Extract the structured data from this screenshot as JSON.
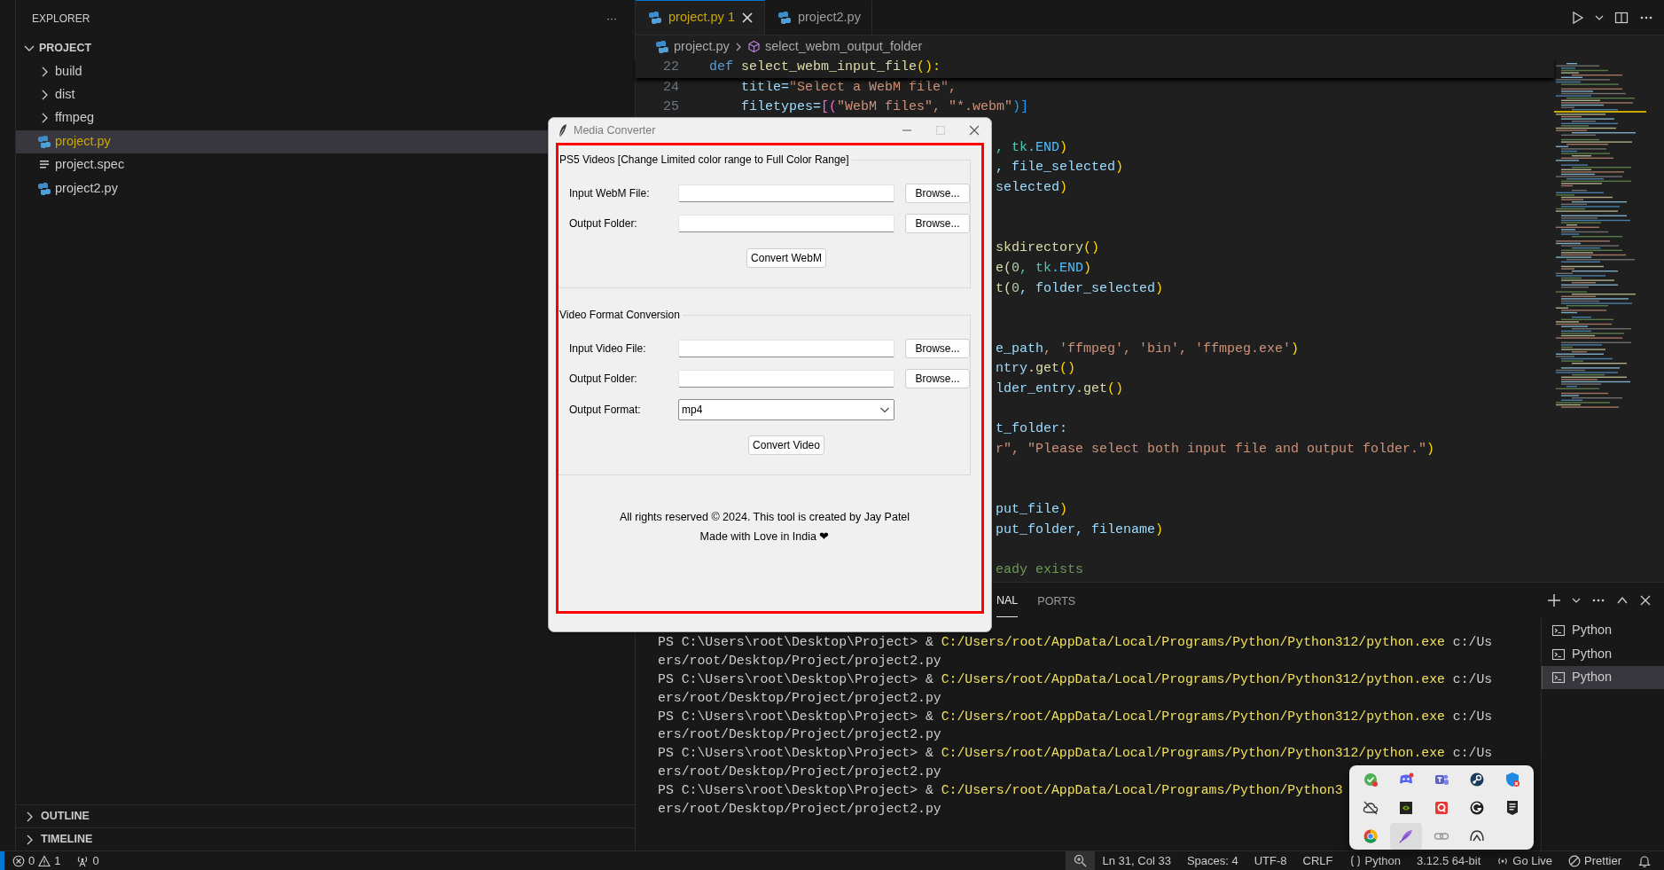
{
  "explorer": {
    "title": "EXPLORER",
    "more": "···",
    "folder": {
      "name": "PROJECT",
      "expanded": true,
      "children": [
        {
          "name": "build",
          "kind": "folder",
          "expanded": false,
          "selected": false,
          "warning": false
        },
        {
          "name": "dist",
          "kind": "folder",
          "expanded": false,
          "selected": false,
          "warning": false
        },
        {
          "name": "ffmpeg",
          "kind": "folder",
          "expanded": false,
          "selected": false,
          "warning": false
        },
        {
          "name": "project.py",
          "kind": "python",
          "selected": true,
          "warning": true
        },
        {
          "name": "project.spec",
          "kind": "text",
          "selected": false,
          "warning": false
        },
        {
          "name": "project2.py",
          "kind": "python",
          "selected": false,
          "warning": false
        }
      ]
    }
  },
  "sections": [
    {
      "name": "OUTLINE",
      "expanded": false
    },
    {
      "name": "TIMELINE",
      "expanded": false
    }
  ],
  "tabs": [
    {
      "label": "project.py",
      "badge": "1",
      "selected": true,
      "warning": true
    },
    {
      "label": "project2.py",
      "selected": false,
      "warning": false
    }
  ],
  "breadcrumb": [
    "project.py",
    "select_webm_output_folder"
  ],
  "editor": {
    "lines": [
      {
        "kind": "code",
        "number": "22",
        "tokens": [
          {
            "text": "def",
            "color": "#569cd6"
          },
          {
            "text": " select_webm_input_file",
            "color": "#dcdcaa"
          },
          {
            "text": "():",
            "color": "#ffd700"
          }
        ]
      },
      {
        "kind": "code",
        "number": "24",
        "tokens": [
          {
            "text": "    title=",
            "color": "#9cdcfe"
          },
          {
            "text": "\"Select a WebM file\",",
            "color": "#ce9178"
          }
        ]
      },
      {
        "kind": "code",
        "number": "25",
        "tokens": [
          {
            "text": "    filetypes=",
            "color": "#9cdcfe"
          },
          {
            "text": "[(",
            "color": "#da70d6"
          },
          {
            "text": "\"WebM files\", \"*.webm\"",
            "color": "#ce9178"
          },
          {
            "text": ")]",
            "color": "#179fff"
          }
        ]
      },
      {
        "kind": "blank"
      },
      {
        "kind": "fragment",
        "tokens": [
          {
            "text": ", tk",
            "color": "#4ec9b0"
          },
          {
            "text": ".END",
            "color": "#4fc1ff"
          },
          {
            "text": ")",
            "color": "#ffd700"
          }
        ]
      },
      {
        "kind": "fragment",
        "tokens": [
          {
            "text": ", file_selected",
            "color": "#9cdcfe"
          },
          {
            "text": ")",
            "color": "#ffd700"
          }
        ]
      },
      {
        "kind": "fragment",
        "tokens": [
          {
            "text": "selected",
            "color": "#9cdcfe"
          },
          {
            "text": ")",
            "color": "#ffd700"
          }
        ]
      },
      {
        "kind": "blank"
      },
      {
        "kind": "blank"
      },
      {
        "kind": "fragment",
        "tokens": [
          {
            "text": "skdirectory",
            "color": "#dcdcaa"
          },
          {
            "text": "()",
            "color": "#ffd700"
          }
        ]
      },
      {
        "kind": "fragment",
        "tokens": [
          {
            "text": "e(",
            "color": "#dcdcaa"
          },
          {
            "text": "0",
            "color": "#b5cea8"
          },
          {
            "text": ", tk",
            "color": "#4ec9b0"
          },
          {
            "text": ".END",
            "color": "#4fc1ff"
          },
          {
            "text": ")",
            "color": "#ffd700"
          }
        ]
      },
      {
        "kind": "fragment",
        "tokens": [
          {
            "text": "t(",
            "color": "#dcdcaa"
          },
          {
            "text": "0",
            "color": "#b5cea8"
          },
          {
            "text": ", folder_selected",
            "color": "#9cdcfe"
          },
          {
            "text": ")",
            "color": "#ffd700"
          }
        ]
      },
      {
        "kind": "blank"
      },
      {
        "kind": "blank"
      },
      {
        "kind": "fragment",
        "tokens": [
          {
            "text": "e_path",
            "color": "#9cdcfe"
          },
          {
            "text": ", 'ffmpeg', 'bin', 'ffmpeg.exe'",
            "color": "#ce9178"
          },
          {
            "text": ")",
            "color": "#ffd700"
          }
        ]
      },
      {
        "kind": "fragment",
        "tokens": [
          {
            "text": "ntry",
            "color": "#9cdcfe"
          },
          {
            "text": ".get",
            "color": "#dcdcaa"
          },
          {
            "text": "()",
            "color": "#ffd700"
          }
        ]
      },
      {
        "kind": "fragment",
        "tokens": [
          {
            "text": "lder_entry",
            "color": "#9cdcfe"
          },
          {
            "text": ".get",
            "color": "#dcdcaa"
          },
          {
            "text": "()",
            "color": "#ffd700"
          }
        ]
      },
      {
        "kind": "blank"
      },
      {
        "kind": "fragment",
        "tokens": [
          {
            "text": "t_folder:",
            "color": "#9cdcfe"
          }
        ]
      },
      {
        "kind": "fragment",
        "tokens": [
          {
            "text": "r\", \"Please select both input file and output folder.\"",
            "color": "#ce9178"
          },
          {
            "text": ")",
            "color": "#ffd700"
          }
        ]
      },
      {
        "kind": "blank"
      },
      {
        "kind": "blank"
      },
      {
        "kind": "fragment",
        "tokens": [
          {
            "text": "put_file",
            "color": "#9cdcfe"
          },
          {
            "text": ")",
            "color": "#ffd700"
          }
        ]
      },
      {
        "kind": "fragment",
        "tokens": [
          {
            "text": "put_folder, filename",
            "color": "#9cdcfe"
          },
          {
            "text": ")",
            "color": "#ffd700"
          }
        ]
      },
      {
        "kind": "blank"
      },
      {
        "kind": "fragment",
        "tokens": [
          {
            "text": "eady exists",
            "color": "#6a9955"
          }
        ]
      }
    ]
  },
  "dialog": {
    "title": "Media Converter",
    "groups": [
      {
        "title": "PS5 Videos [Change Limited color range to Full Color Range]",
        "fields": [
          {
            "label": "Input WebM File:",
            "kind": "entry",
            "button": "Browse..."
          },
          {
            "label": "Output Folder:",
            "kind": "entry",
            "button": "Browse..."
          }
        ],
        "action": "Convert WebM"
      },
      {
        "title": "Video Format Conversion",
        "fields": [
          {
            "label": "Input Video File:",
            "kind": "entry",
            "button": "Browse..."
          },
          {
            "label": "Output Folder:",
            "kind": "entry",
            "button": "Browse..."
          },
          {
            "label": "Output Format:",
            "kind": "combo",
            "value": "mp4"
          }
        ],
        "action": "Convert Video"
      }
    ],
    "footer": [
      "All rights reserved © 2024. This tool is created by Jay Patel",
      "Made with Love in India ❤"
    ]
  },
  "panel": {
    "tabs": [
      {
        "label": "NAL",
        "selected": true
      },
      {
        "label": "PORTS",
        "selected": false
      }
    ],
    "terminal_lines": [
      {
        "kind": "command",
        "prompt": "PS C:\\Users\\root\\Desktop\\Project> & ",
        "path": "C:/Users/root/AppData/Local/Programs/Python/Python312/python.exe",
        "arg": " c:/Us"
      },
      {
        "kind": "output",
        "text": "ers/root/Desktop/Project/project2.py"
      },
      {
        "kind": "command",
        "prompt": "PS C:\\Users\\root\\Desktop\\Project> & ",
        "path": "C:/Users/root/AppData/Local/Programs/Python/Python312/python.exe",
        "arg": " c:/Us"
      },
      {
        "kind": "output",
        "text": "ers/root/Desktop/Project/project2.py"
      },
      {
        "kind": "command",
        "prompt": "PS C:\\Users\\root\\Desktop\\Project> & ",
        "path": "C:/Users/root/AppData/Local/Programs/Python/Python312/python.exe",
        "arg": " c:/Us"
      },
      {
        "kind": "output",
        "text": "ers/root/Desktop/Project/project2.py"
      },
      {
        "kind": "command",
        "prompt": "PS C:\\Users\\root\\Desktop\\Project> & ",
        "path": "C:/Users/root/AppData/Local/Programs/Python/Python312/python.exe",
        "arg": " c:/Us"
      },
      {
        "kind": "output",
        "text": "ers/root/Desktop/Project/project2.py"
      },
      {
        "kind": "command",
        "prompt": "PS C:\\Users\\root\\Desktop\\Project> & ",
        "path": "C:/Users/root/AppData/Local/Programs/Python/Python3"
      },
      {
        "kind": "output",
        "text": "ers/root/Desktop/Project/project2.py"
      }
    ],
    "terminals": [
      {
        "label": "Python",
        "selected": false
      },
      {
        "label": "Python",
        "selected": false
      },
      {
        "label": "Python",
        "selected": true
      }
    ]
  },
  "status_bar": {
    "errors": "0",
    "warnings": "1",
    "ports": "0",
    "position": "Ln 31, Col 33",
    "indent": "Spaces: 4",
    "encoding": "UTF-8",
    "eol": "CRLF",
    "language": "Python",
    "interpreter": "3.12.5 64-bit",
    "live": "Go Live",
    "formatter": "Prettier"
  },
  "tray": {
    "items": [
      {
        "kind": "shield-check",
        "selected": false
      },
      {
        "kind": "controller",
        "selected": false
      },
      {
        "kind": "people",
        "selected": false
      },
      {
        "kind": "wheel",
        "selected": false
      },
      {
        "kind": "shield-x",
        "selected": false
      },
      {
        "kind": "cloud-off",
        "selected": false
      },
      {
        "kind": "chip",
        "selected": false
      },
      {
        "kind": "ring-tile",
        "selected": false
      },
      {
        "kind": "circle-g",
        "selected": false
      },
      {
        "kind": "dark-tile",
        "selected": false
      },
      {
        "kind": "color-wheel",
        "selected": false
      },
      {
        "kind": "feather",
        "selected": true
      },
      {
        "kind": "link",
        "selected": false
      },
      {
        "kind": "arch",
        "selected": false
      }
    ]
  }
}
